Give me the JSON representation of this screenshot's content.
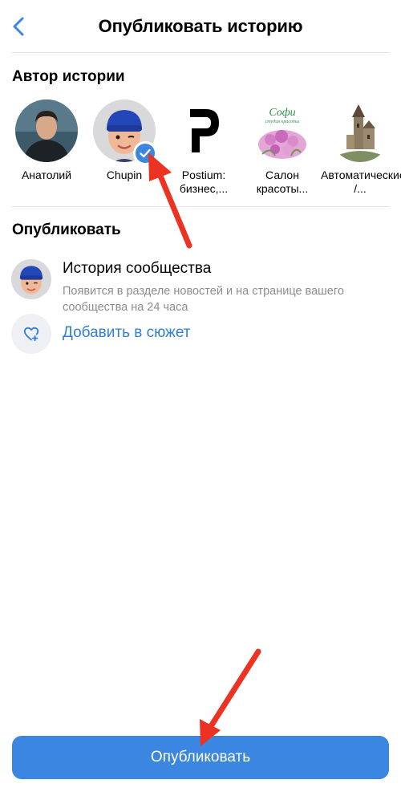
{
  "header": {
    "title": "Опубликовать историю"
  },
  "author_section": {
    "title": "Автор истории",
    "authors": [
      {
        "name": "Анатолий",
        "selected": false
      },
      {
        "name": "Chupin",
        "selected": true
      },
      {
        "name": "Postium: бизнес,...",
        "selected": false
      },
      {
        "name": "Салон красоты...",
        "selected": false,
        "logo_text": "Софи",
        "logo_subtext": "студия красоты"
      },
      {
        "name": "Автоматические /...",
        "selected": false
      }
    ]
  },
  "publish_section": {
    "title": "Опубликовать",
    "community_story": {
      "title": "История сообщества",
      "description": "Появится в разделе новостей и на странице вашего сообщества на 24 часа"
    },
    "add_to_plot": {
      "label": "Добавить в сюжет"
    }
  },
  "publish_button": {
    "label": "Опубликовать"
  },
  "colors": {
    "accent": "#3a86e0",
    "link": "#2f7fd6",
    "annotation_arrow": "#ec3323"
  }
}
